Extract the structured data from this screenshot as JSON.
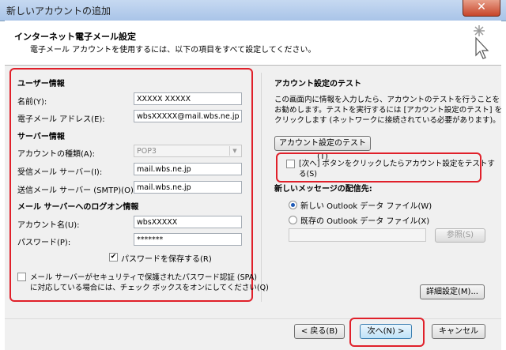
{
  "window": {
    "title": "新しいアカウントの追加",
    "close_glyph": "✕"
  },
  "header": {
    "title": "インターネット電子メール設定",
    "subtitle": "電子メール アカウントを使用するには、以下の項目をすべて設定してください。"
  },
  "user_info": {
    "section": "ユーザー情報",
    "name_label": "名前(Y):",
    "name_value": "XXXXX XXXXX",
    "email_label": "電子メール アドレス(E):",
    "email_value": "wbsXXXXX@mail.wbs.ne.jp"
  },
  "server_info": {
    "section": "サーバー情報",
    "type_label": "アカウントの種類(A):",
    "type_value": "POP3",
    "incoming_label": "受信メール サーバー(I):",
    "incoming_value": "mail.wbs.ne.jp",
    "outgoing_label": "送信メール サーバー (SMTP)(O):",
    "outgoing_value": "mail.wbs.ne.jp"
  },
  "logon_info": {
    "section": "メール サーバーへのログオン情報",
    "account_label": "アカウント名(U):",
    "account_value": "wbsXXXXX",
    "password_label": "パスワード(P):",
    "password_value": "*******",
    "save_password_label": "パスワードを保存する(R)",
    "spa_label_1": "メール サーバーがセキュリティで保護されたパスワード認証 (SPA)",
    "spa_label_2": "に対応している場合には、チェック ボックスをオンにしてください(Q)"
  },
  "test": {
    "section": "アカウント設定のテスト",
    "desc_1": "この画面内に情報を入力したら、アカウントのテストを行うことを",
    "desc_2": "お勧めします。テストを実行するには [アカウント設定のテスト] を",
    "desc_3": "クリックします (ネットワークに接続されている必要があります)。",
    "test_button": "アカウント設定のテスト(T)",
    "auto_test_1": "[次へ] ボタンをクリックしたらアカウント設定をテストす",
    "auto_test_2": "る(S)"
  },
  "delivery": {
    "section": "新しいメッセージの配信先:",
    "new_file": "新しい Outlook データ ファイル(W)",
    "existing_file": "既存の Outlook データ ファイル(X)",
    "browse_button": "参照(S)",
    "more_settings_button": "詳細設定(M)..."
  },
  "footer": {
    "back_button": "< 戻る(B)",
    "next_button": "次へ(N) >",
    "cancel_button": "キャンセル"
  },
  "colors": {
    "highlight": "#e0202a"
  }
}
